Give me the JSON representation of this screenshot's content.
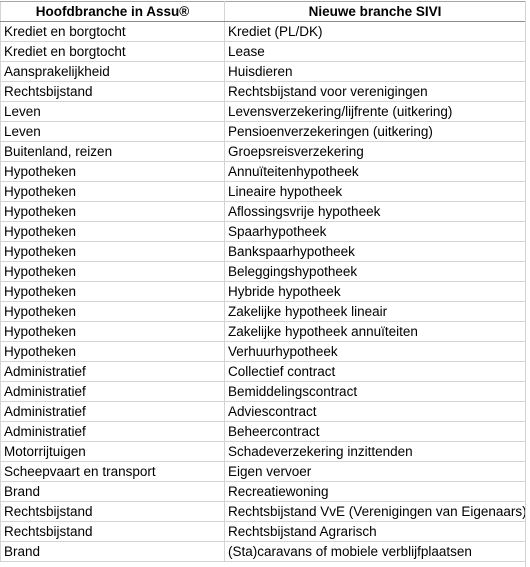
{
  "table": {
    "headers": [
      "Hoofdbranche in Assu®",
      "Nieuwe branche SIVI"
    ],
    "rows": [
      [
        "Krediet en borgtocht",
        "Krediet (PL/DK)"
      ],
      [
        "Krediet en borgtocht",
        "Lease"
      ],
      [
        "Aansprakelijkheid",
        "Huisdieren"
      ],
      [
        "Rechtsbijstand",
        "Rechtsbijstand voor verenigingen"
      ],
      [
        "Leven",
        "Levensverzekering/lijfrente (uitkering)"
      ],
      [
        "Leven",
        "Pensioenverzekeringen (uitkering)"
      ],
      [
        "Buitenland, reizen",
        "Groepsreisverzekering"
      ],
      [
        "Hypotheken",
        "Annuïteitenhypotheek"
      ],
      [
        "Hypotheken",
        "Lineaire hypotheek"
      ],
      [
        "Hypotheken",
        "Aflossingsvrije hypotheek"
      ],
      [
        "Hypotheken",
        "Spaarhypotheek"
      ],
      [
        "Hypotheken",
        "Bankspaarhypotheek"
      ],
      [
        "Hypotheken",
        "Beleggingshypotheek"
      ],
      [
        "Hypotheken",
        "Hybride hypotheek"
      ],
      [
        "Hypotheken",
        "Zakelijke hypotheek lineair"
      ],
      [
        "Hypotheken",
        "Zakelijke hypotheek annuïteiten"
      ],
      [
        "Hypotheken",
        "Verhuurhypotheek"
      ],
      [
        "Administratief",
        "Collectief contract"
      ],
      [
        "Administratief",
        "Bemiddelingscontract"
      ],
      [
        "Administratief",
        "Adviescontract"
      ],
      [
        "Administratief",
        "Beheercontract"
      ],
      [
        "Motorrijtuigen",
        "Schadeverzekering inzittenden"
      ],
      [
        "Scheepvaart en transport",
        "Eigen vervoer"
      ],
      [
        "Brand",
        "Recreatiewoning"
      ],
      [
        "Rechtsbijstand",
        "Rechtsbijstand VvE (Verenigingen van Eigenaars)"
      ],
      [
        "Rechtsbijstand",
        "Rechtsbijstand Agrarisch"
      ],
      [
        "Brand",
        "(Sta)caravans of mobiele verblijfplaatsen"
      ]
    ]
  },
  "colors": {
    "gridline": "#d4d4d4",
    "header_border": "#8c8c8c",
    "text": "#000000",
    "background": "#ffffff"
  }
}
